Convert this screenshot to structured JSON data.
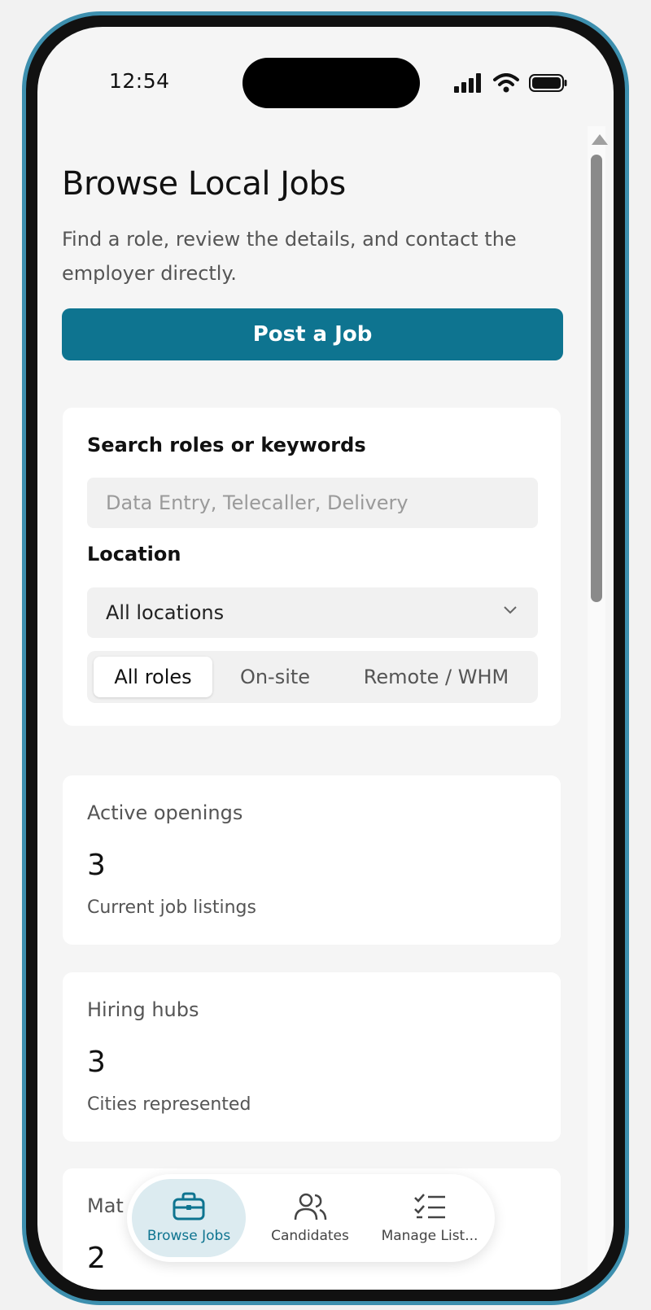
{
  "status_bar": {
    "time": "12:54"
  },
  "header": {
    "title": "Browse Local Jobs",
    "subtitle": "Find a role, review the details, and contact the employer directly.",
    "post_button": "Post a Job"
  },
  "filters": {
    "search_label": "Search roles or keywords",
    "search_placeholder": "Data Entry, Telecaller, Delivery",
    "search_value": "",
    "location_label": "Location",
    "location_value": "All locations",
    "segments": [
      "All roles",
      "On-site",
      "Remote / WHM"
    ],
    "selected_segment": "All roles"
  },
  "stats": [
    {
      "label": "Active openings",
      "value": "3",
      "sub": "Current job listings"
    },
    {
      "label": "Hiring hubs",
      "value": "3",
      "sub": "Cities represented"
    },
    {
      "label": "Mat",
      "value": "2",
      "sub": ""
    }
  ],
  "bottom_nav": {
    "items": [
      {
        "label": "Browse Jobs",
        "icon": "briefcase-icon",
        "active": true
      },
      {
        "label": "Candidates",
        "icon": "users-icon",
        "active": false
      },
      {
        "label": "Manage List...",
        "icon": "checklist-icon",
        "active": false
      }
    ]
  },
  "colors": {
    "accent": "#0e7490",
    "nav_active_bg": "#dcebf0",
    "frame": "#3d8fae"
  }
}
